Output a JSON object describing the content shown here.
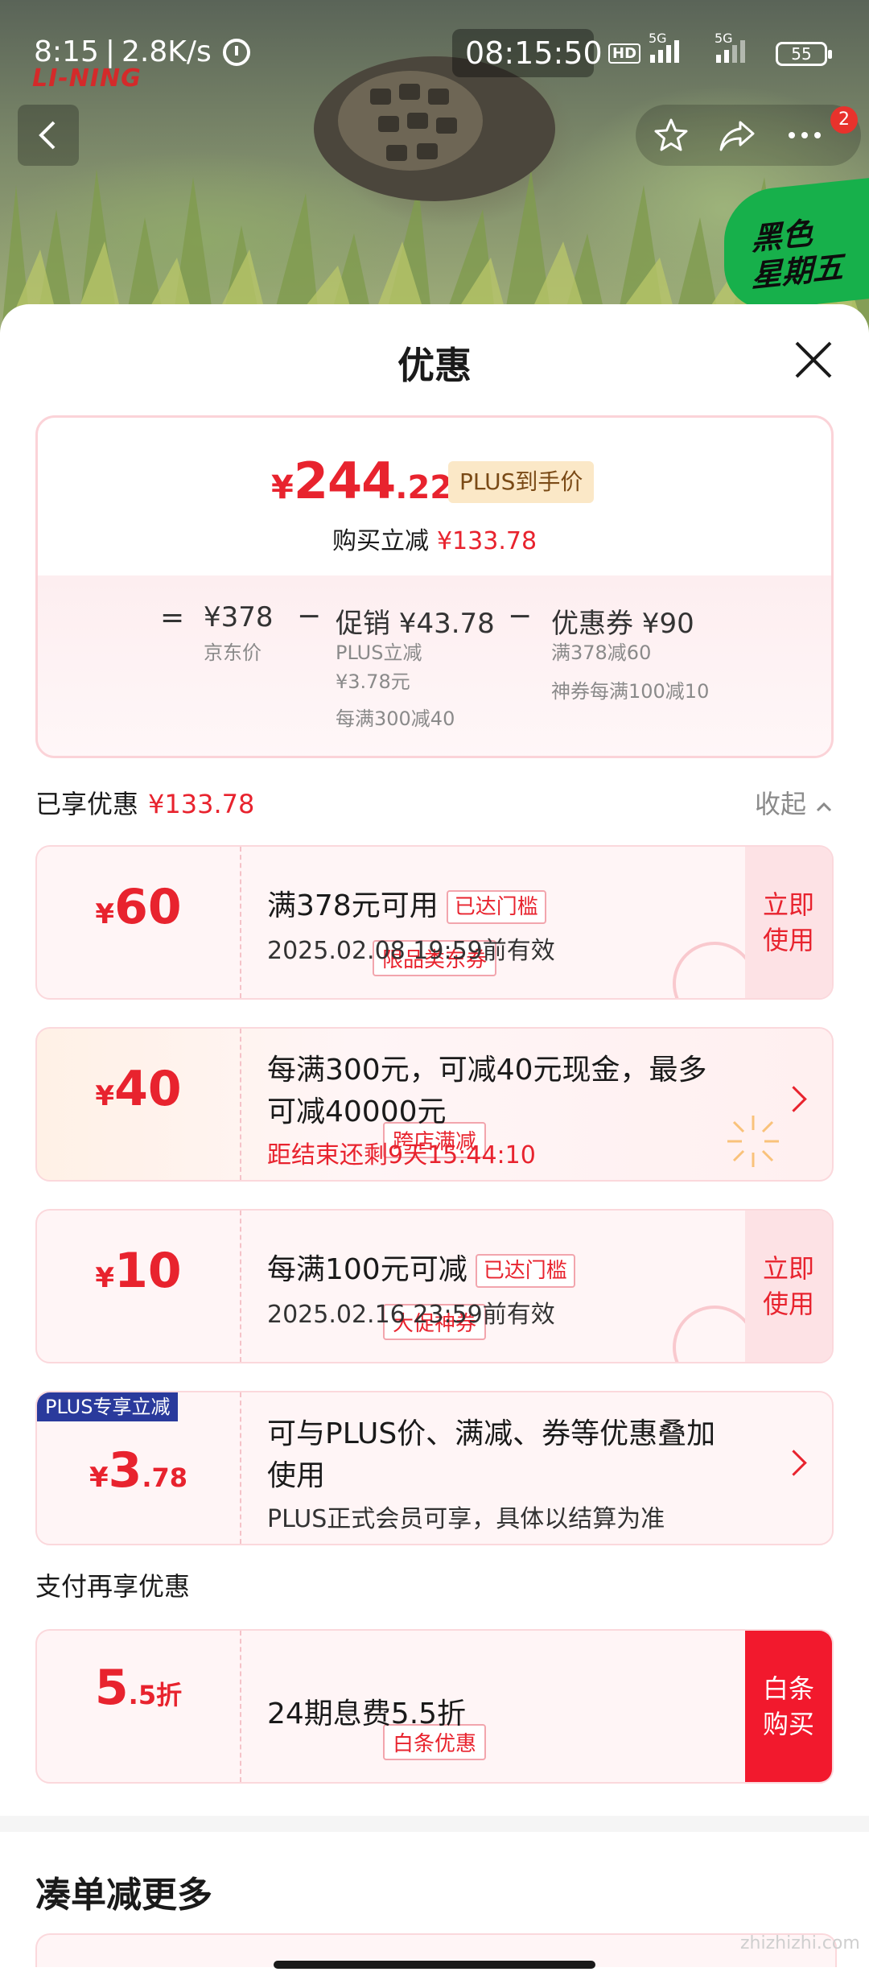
{
  "status_bar": {
    "time": "8:15",
    "speed": "2.8K/s",
    "clock": "08:15:50",
    "hd": "HD",
    "net1": "5G",
    "net2": "5G",
    "battery": "55"
  },
  "hero": {
    "brand": "LI-NING",
    "badge_line1": "黑色",
    "badge_line2": "星期五",
    "notification_count": "2"
  },
  "sheet": {
    "title": "优惠"
  },
  "summary": {
    "price_symbol": "¥",
    "price_int": "244",
    "price_dec": ".22",
    "price_tag": "PLUS到手价",
    "buy_reduce_label": "购买立减",
    "buy_reduce_value": "¥133.78",
    "eq": "=",
    "minus": "−",
    "jd_price": "¥378",
    "jd_price_label": "京东价",
    "promo": "促销 ¥43.78",
    "promo_sub1": "PLUS立减",
    "promo_sub2": "¥3.78元",
    "promo_sub3": "每满300减40",
    "coupon": "优惠券 ¥90",
    "coupon_sub1": "满378减60",
    "coupon_sub2": "神券每满100减10"
  },
  "enjoyed": {
    "label": "已享优惠",
    "value": "¥133.78",
    "collapse": "收起"
  },
  "coupons": [
    {
      "sym": "¥",
      "amount": "60",
      "tag": "限品类东券",
      "line1": "满378元可用",
      "reached": "已达门槛",
      "line2": "2025.02.08 19:59前有效",
      "action": "立即\n使用"
    },
    {
      "sym": "¥",
      "amount": "40",
      "tag": "跨店满减",
      "line1": "每满300元，可减40元现金，最多",
      "line1b": "可减40000元",
      "line2": "距结束还剩9天15:44:10"
    },
    {
      "sym": "¥",
      "amount": "10",
      "tag": "大促神券",
      "line1": "每满100元可减",
      "reached": "已达门槛",
      "line2": "2025.02.16 23:59前有效",
      "action": "立即\n使用"
    },
    {
      "head": "PLUS专享立减",
      "sym": "¥",
      "amount": "3",
      "amount_dec": ".78",
      "line1": "可与PLUS价、满减、券等优惠叠加",
      "line1b": "使用",
      "line2": "PLUS正式会员可享，具体以结算为准"
    }
  ],
  "pay_section": {
    "label": "支付再享优惠",
    "amount": "5",
    "amount_dec": ".5折",
    "tag": "白条优惠",
    "line": "24期息费5.5折",
    "action": "白条\n购买"
  },
  "more": {
    "title": "凑单减更多"
  },
  "watermark": "zhizhizhi.com",
  "colors": {
    "accent_red": "#e8232e",
    "plus_blue": "#2a3a9c",
    "badge_green": "#17b04b",
    "card_bg": "#fff5f6"
  }
}
